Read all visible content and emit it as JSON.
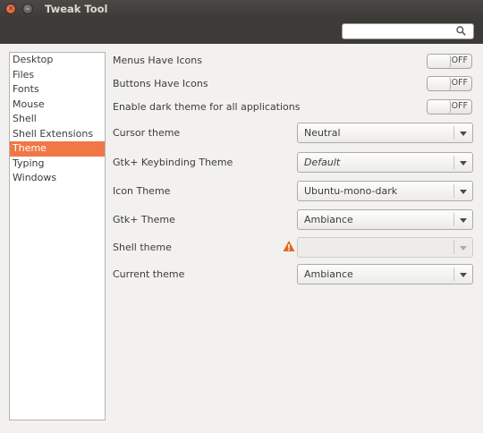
{
  "window": {
    "title": "Tweak Tool"
  },
  "titlebar": {
    "close_icon": "close-icon",
    "minimize_icon": "minimize-icon"
  },
  "search": {
    "value": "",
    "placeholder": "",
    "icon": "search-icon"
  },
  "sidebar": {
    "items": [
      {
        "label": "Desktop",
        "selected": false
      },
      {
        "label": "Files",
        "selected": false
      },
      {
        "label": "Fonts",
        "selected": false
      },
      {
        "label": "Mouse",
        "selected": false
      },
      {
        "label": "Shell",
        "selected": false
      },
      {
        "label": "Shell Extensions",
        "selected": false
      },
      {
        "label": "Theme",
        "selected": true
      },
      {
        "label": "Typing",
        "selected": false
      },
      {
        "label": "Windows",
        "selected": false
      }
    ]
  },
  "settings": {
    "menus_icons": {
      "label": "Menus Have Icons",
      "state": "OFF"
    },
    "buttons_icons": {
      "label": "Buttons Have Icons",
      "state": "OFF"
    },
    "dark_theme": {
      "label": "Enable dark theme for all applications",
      "state": "OFF"
    },
    "cursor_theme": {
      "label": "Cursor theme",
      "value": "Neutral"
    },
    "keybinding_theme": {
      "label": "Gtk+ Keybinding Theme",
      "value": "Default"
    },
    "icon_theme": {
      "label": "Icon Theme",
      "value": "Ubuntu-mono-dark"
    },
    "gtk_theme": {
      "label": "Gtk+ Theme",
      "value": "Ambiance"
    },
    "shell_theme": {
      "label": "Shell theme",
      "value": "",
      "icon": "warning-icon"
    },
    "current_theme": {
      "label": "Current theme",
      "value": "Ambiance"
    }
  },
  "colors": {
    "accent": "#f07746",
    "titlebar": "#3c3b37",
    "window_bg": "#f2f1f0",
    "warning": "#e2691f"
  }
}
